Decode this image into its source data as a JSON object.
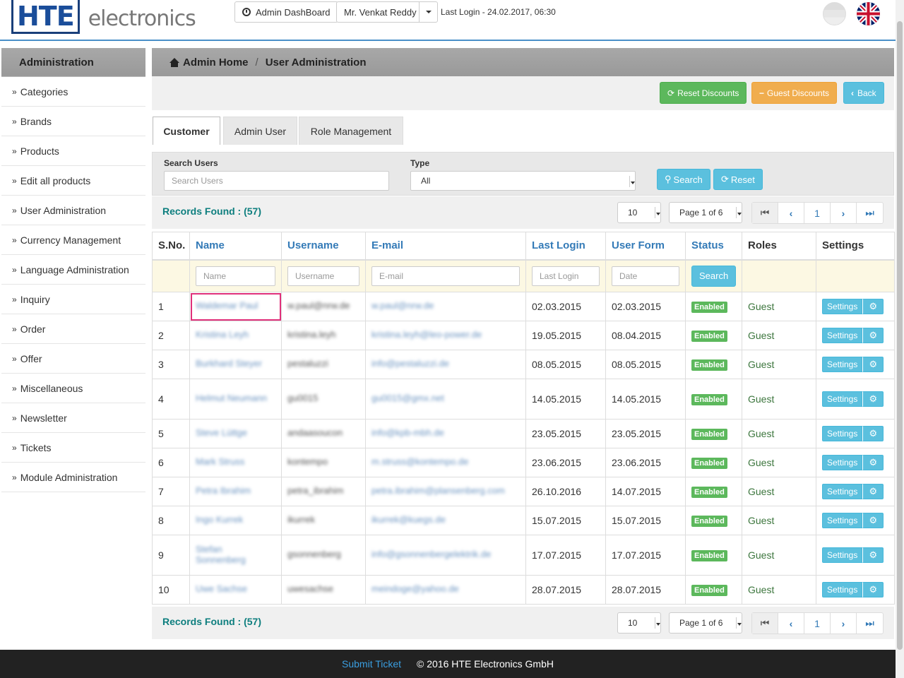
{
  "header": {
    "logo_mark": "HTE",
    "logo_text": "electronics",
    "dashboard_label": "Admin DashBoard",
    "user_label": "Mr. Venkat Reddy",
    "last_login": "Last Login - 24.02.2017, 06:30"
  },
  "sidebar": {
    "title": "Administration",
    "items": [
      "Categories",
      "Brands",
      "Products",
      "Edit all products",
      "User Administration",
      "Currency Management",
      "Language Administration",
      "Inquiry",
      "Order",
      "Offer",
      "Miscellaneous",
      "Newsletter",
      "Tickets",
      "Module Administration"
    ]
  },
  "breadcrumb": {
    "home": "Admin Home",
    "separator": "/",
    "current": "User Administration"
  },
  "toolbar": {
    "reset_discounts": "Reset Discounts",
    "guest_discounts": "Guest Discounts",
    "back": "Back"
  },
  "tabs": [
    "Customer",
    "Admin User",
    "Role Management"
  ],
  "filter": {
    "search_label": "Search Users",
    "search_placeholder": "Search Users",
    "type_label": "Type",
    "type_value": "All",
    "search_button": "Search",
    "reset_button": "Reset"
  },
  "pager": {
    "records_label": "Records Found : (57)",
    "page_size": "10",
    "page_select": "Page 1 of 6",
    "current_page": "1"
  },
  "table": {
    "headers": [
      "S.No.",
      "Name",
      "Username",
      "E-mail",
      "Last Login",
      "User Form",
      "Status",
      "Roles",
      "Settings"
    ],
    "filter_placeholders": {
      "name": "Name",
      "username": "Username",
      "email": "E-mail",
      "last_login": "Last Login",
      "date": "Date"
    },
    "filter_search": "Search",
    "settings_label": "Settings",
    "rows": [
      {
        "sno": "1",
        "name": "Waldemar Paul",
        "username": "w.paul@nrw.de",
        "email": "w.paul@nrw.de",
        "last_login": "02.03.2015",
        "user_form": "02.03.2015",
        "status": "Enabled",
        "role": "Guest"
      },
      {
        "sno": "2",
        "name": "Kristina Leyh",
        "username": "kristina.leyh",
        "email": "kristina.leyh@leo-power.de",
        "last_login": "19.05.2015",
        "user_form": "08.04.2015",
        "status": "Enabled",
        "role": "Guest"
      },
      {
        "sno": "3",
        "name": "Burkhard Steyer",
        "username": "pestaluzzi",
        "email": "info@pestaluzzi.de",
        "last_login": "08.05.2015",
        "user_form": "08.05.2015",
        "status": "Enabled",
        "role": "Guest"
      },
      {
        "sno": "4",
        "name": "Helmut Neumann",
        "username": "gu0015",
        "email": "gu0015@gmx.net",
        "last_login": "14.05.2015",
        "user_form": "14.05.2015",
        "status": "Enabled",
        "role": "Guest"
      },
      {
        "sno": "5",
        "name": "Steve Lüttge",
        "username": "andaasoucon",
        "email": "info@kpb-mbh.de",
        "last_login": "23.05.2015",
        "user_form": "23.05.2015",
        "status": "Enabled",
        "role": "Guest"
      },
      {
        "sno": "6",
        "name": "Mark Struss",
        "username": "kontempo",
        "email": "m.struss@kontempo.de",
        "last_login": "23.06.2015",
        "user_form": "23.06.2015",
        "status": "Enabled",
        "role": "Guest"
      },
      {
        "sno": "7",
        "name": "Petra Ibrahim",
        "username": "petra_ibrahim",
        "email": "petra.ibrahim@plansenberg.com",
        "last_login": "26.10.2016",
        "user_form": "14.07.2015",
        "status": "Enabled",
        "role": "Guest"
      },
      {
        "sno": "8",
        "name": "Ingo Kurrek",
        "username": "ikurrek",
        "email": "ikurrek@kuegs.de",
        "last_login": "15.07.2015",
        "user_form": "15.07.2015",
        "status": "Enabled",
        "role": "Guest"
      },
      {
        "sno": "9",
        "name": "Stefan Sonnenberg",
        "username": "gsonnenberg",
        "email": "info@gsonnenbergelektrik.de",
        "last_login": "17.07.2015",
        "user_form": "17.07.2015",
        "status": "Enabled",
        "role": "Guest"
      },
      {
        "sno": "10",
        "name": "Uwe Sachse",
        "username": "uwesachse",
        "email": "meindoge@yahoo.de",
        "last_login": "28.07.2015",
        "user_form": "28.07.2015",
        "status": "Enabled",
        "role": "Guest"
      }
    ]
  },
  "footer": {
    "submit_ticket": "Submit Ticket",
    "copyright": "© 2016 HTE Electronics GmbH"
  },
  "colors": {
    "accent": "#337ab7",
    "success": "#5cb85c",
    "warning": "#f0ad4e",
    "info": "#5bc0de",
    "records": "#0d7e7e"
  }
}
